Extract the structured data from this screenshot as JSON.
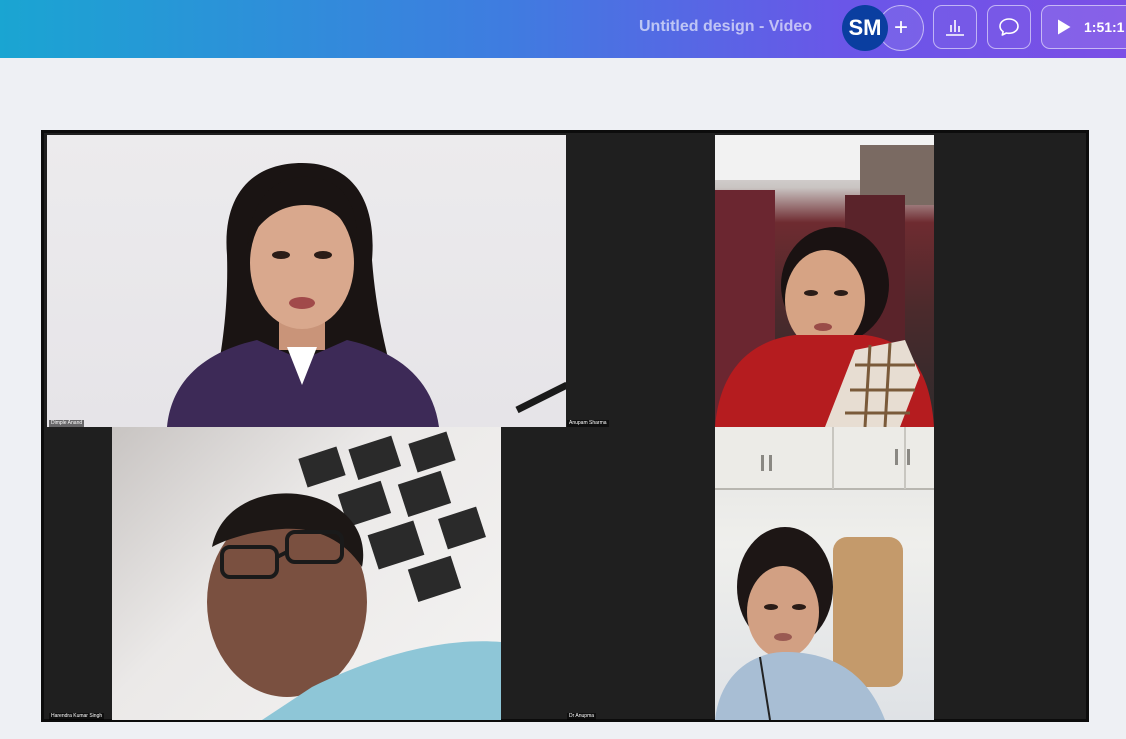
{
  "header": {
    "doc_title": "Untitled design - Video",
    "avatar_initials": "SM",
    "add_member_label": "+",
    "play_time": "1:51:1"
  },
  "icons": {
    "add": "plus-icon",
    "insights": "bar-chart-icon",
    "comment": "speech-bubble-icon",
    "play": "play-icon"
  },
  "colors": {
    "avatar_bg": "#0a3ea0",
    "gradient_start": "#1aa5d2",
    "gradient_end": "#7b4fe6"
  },
  "participants": [
    {
      "name": "Dimple Anand"
    },
    {
      "name": "Anupam Sharma"
    },
    {
      "name": "Harendra Kumar Singh"
    },
    {
      "name": "Dr Anupma"
    }
  ]
}
